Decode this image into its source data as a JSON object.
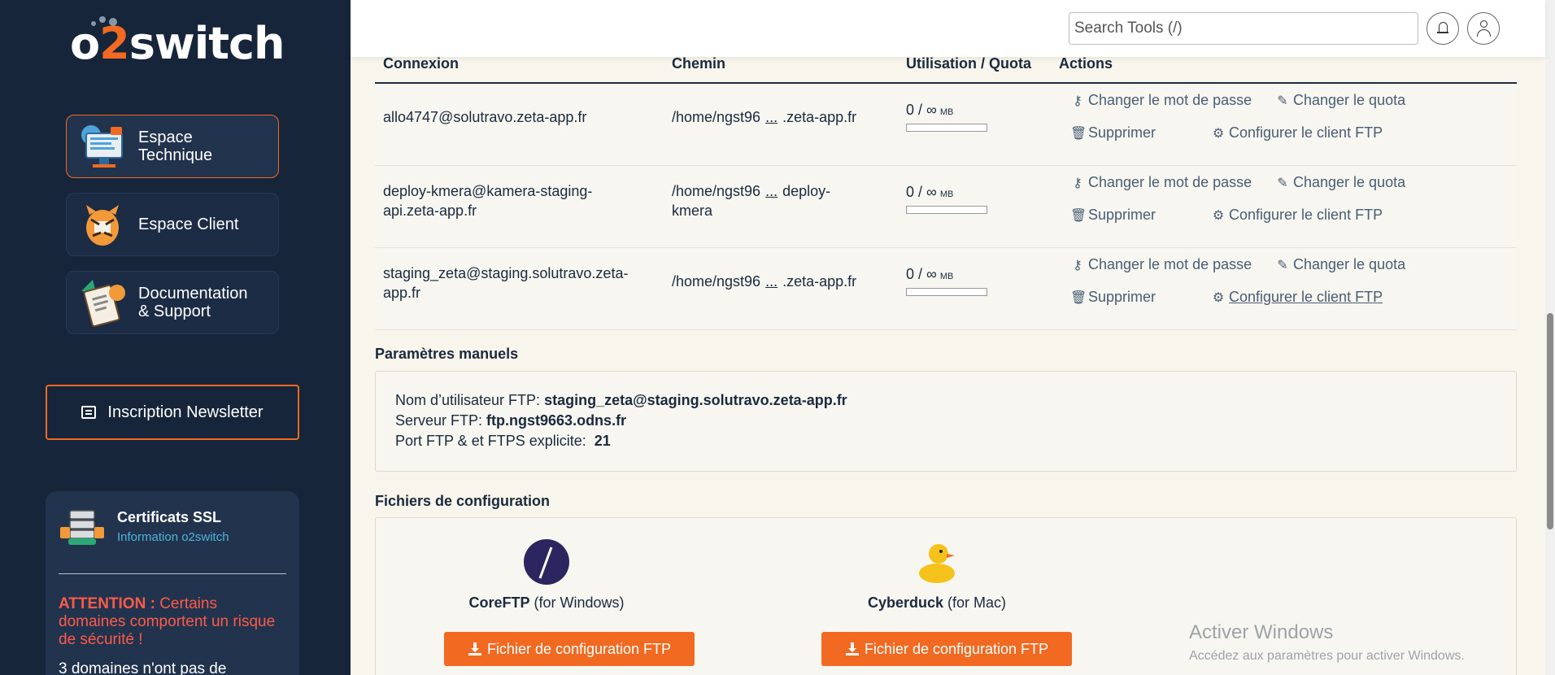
{
  "brand": {
    "logo_prefix": "o",
    "logo_accent": "2",
    "logo_suffix": "switch"
  },
  "sidebar": {
    "items": [
      {
        "label_line1": "Espace",
        "label_line2": "Technique"
      },
      {
        "label_line1": "Espace Client"
      },
      {
        "label_line1": "Documentation",
        "label_line2": "& Support"
      }
    ],
    "newsletter_label": "Inscription Newsletter",
    "ssl": {
      "title": "Certificats SSL",
      "subtitle": "Information o2switch",
      "warn_bold": "ATTENTION :",
      "warn_text": " Certains domaines comportent un risque de sécurité !",
      "more_text": "3 domaines n'ont pas de"
    }
  },
  "topbar": {
    "search_placeholder": "Search Tools (/)"
  },
  "table": {
    "headers": [
      "Connexion",
      "Chemin",
      "Utilisation / Quota",
      "Actions"
    ],
    "rows": [
      {
        "connexion": "allo4747@solutravo.zeta-app.fr",
        "path_start": "/home/ngst96",
        "path_ellipsis": "...",
        "path_end": ".zeta-app.fr",
        "quota_used": "0 /",
        "quota_max": "∞",
        "quota_unit": "MB",
        "usage_fraction": 0
      },
      {
        "connexion": "deploy-kmera@kamera-staging-api.zeta-app.fr",
        "path_start": "/home/ngst96",
        "path_ellipsis": "...",
        "path_end": "deploy-kmera",
        "quota_used": "0 /",
        "quota_max": "∞",
        "quota_unit": "MB",
        "usage_fraction": 0
      },
      {
        "connexion": "staging_zeta@staging.solutravo.zeta-app.fr",
        "path_start": "/home/ngst96",
        "path_ellipsis": "...",
        "path_end": ".zeta-app.fr",
        "quota_used": "0 /",
        "quota_max": "∞",
        "quota_unit": "MB",
        "usage_fraction": 0
      }
    ],
    "actions": {
      "change_password": "Changer le mot de passe",
      "change_quota": "Changer le quota",
      "delete": "Supprimer",
      "configure": "Configurer le client FTP"
    }
  },
  "manual": {
    "title": "Paramètres manuels",
    "user_label": "Nom d’utilisateur FTP:",
    "user_value": "staging_zeta@staging.solutravo.zeta-app.fr",
    "server_label": "Serveur FTP:",
    "server_value": "ftp.ngst9663.odns.fr",
    "port_label": "Port FTP & et FTPS explicite:",
    "port_value": "21"
  },
  "config_files": {
    "title": "Fichiers de configuration",
    "clients": [
      {
        "name": "CoreFTP",
        "platform": " (for Windows)",
        "button": "Fichier de configuration FTP"
      },
      {
        "name": "Cyberduck",
        "platform": " (for Mac)",
        "button": "Fichier de configuration FTP"
      }
    ]
  },
  "windows_watermark": {
    "line1": "Activer Windows",
    "line2": "Accédez aux paramètres pour activer Windows."
  },
  "colors": {
    "sidebar_bg": "#16253a",
    "accent": "#f26a21",
    "content_bg": "#f8f5ec",
    "link": "#4a5d73"
  }
}
